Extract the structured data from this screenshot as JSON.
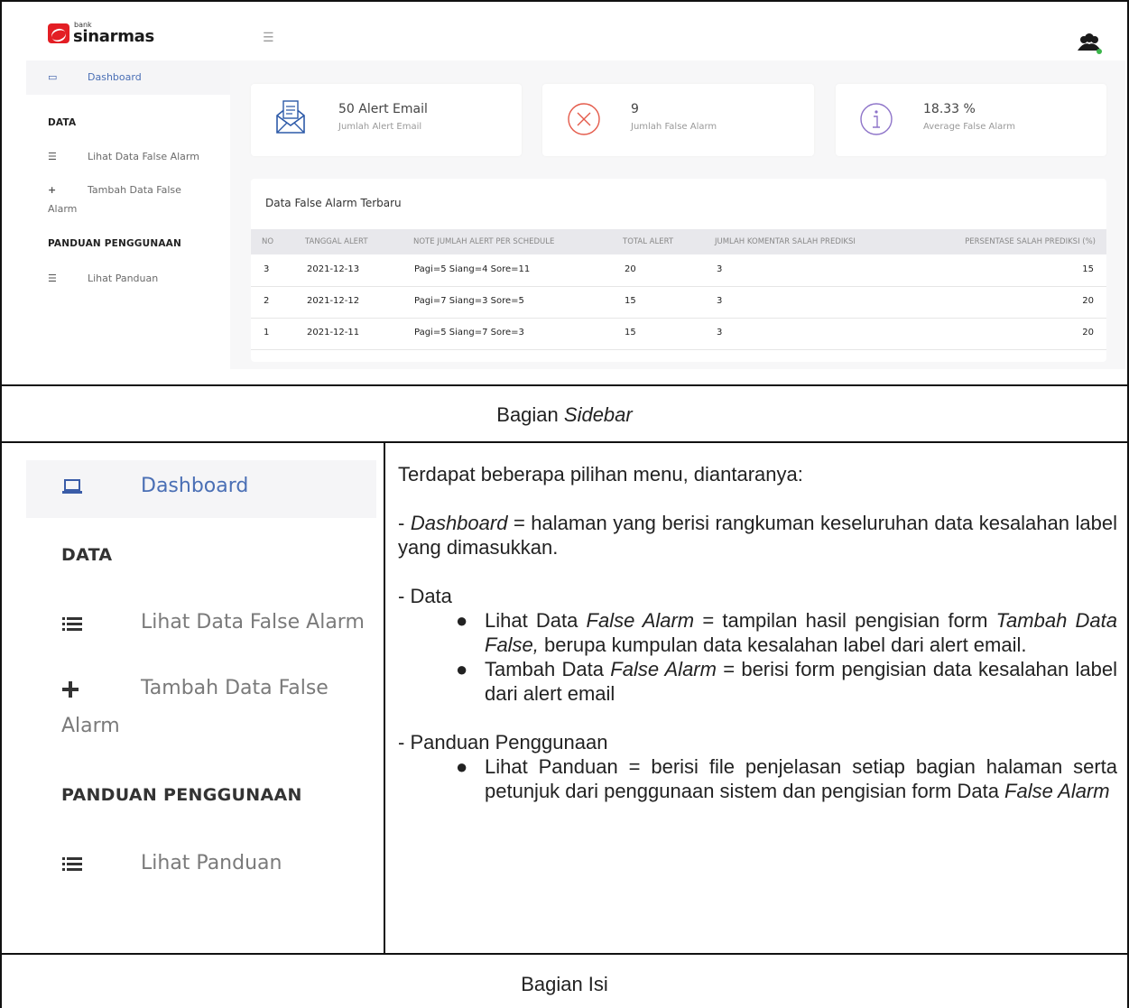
{
  "app": {
    "logo_small": "bank",
    "logo_name": "sinarmas"
  },
  "sidebar": {
    "dashboard": "Dashboard",
    "section_data": "DATA",
    "lihat_data": "Lihat Data False Alarm",
    "tambah_line1": "Tambah Data False",
    "tambah_line2": "Alarm",
    "section_panduan": "PANDUAN PENGGUNAAN",
    "lihat_panduan": "Lihat Panduan"
  },
  "cards": [
    {
      "value": "50 Alert Email",
      "label": "Jumlah Alert Email",
      "icon": "email-icon"
    },
    {
      "value": "9",
      "label": "Jumlah False Alarm",
      "icon": "x-circle-icon"
    },
    {
      "value": "18.33 %",
      "label": "Average False Alarm",
      "icon": "info-circle-icon"
    }
  ],
  "table": {
    "title": "Data False Alarm Terbaru",
    "headers": [
      "NO",
      "TANGGAL ALERT",
      "NOTE JUMLAH ALERT PER SCHEDULE",
      "TOTAL ALERT",
      "JUMLAH KOMENTAR SALAH PREDIKSI",
      "PERSENTASE SALAH PREDIKSI (%)"
    ],
    "rows": [
      [
        "3",
        "2021-12-13",
        "Pagi=5 Siang=4 Sore=11",
        "20",
        "3",
        "15"
      ],
      [
        "2",
        "2021-12-12",
        "Pagi=7 Siang=3 Sore=5",
        "15",
        "3",
        "20"
      ],
      [
        "1",
        "2021-12-11",
        "Pagi=5 Siang=7 Sore=3",
        "15",
        "3",
        "20"
      ]
    ]
  },
  "captions": {
    "sidebar_prefix": "Bagian ",
    "sidebar_italic": "Sidebar",
    "isi": "Bagian Isi"
  },
  "description": {
    "intro": "Terdapat beberapa pilihan menu, diantaranya:",
    "dash_dash": "- ",
    "dash_italic": "Dashboard",
    "dash_text": " = halaman yang berisi rangkuman keseluruhan data kesalahan label yang dimasukkan.",
    "data_heading": "- Data",
    "b1_a": "Lihat Data ",
    "b1_i1": "False Alarm",
    "b1_b": " = tampilan  hasil pengisian form ",
    "b1_i2": "Tambah Data False,",
    "b1_c": " berupa kumpulan data kesalahan label dari alert email.",
    "b2_a": "Tambah Data ",
    "b2_i": "False Alarm",
    "b2_b": " = berisi form pengisian data kesalahan label dari alert email",
    "panduan_heading": "- Panduan Penggunaan",
    "b3_a": "Lihat Panduan = berisi file penjelasan setiap bagian halaman serta petunjuk dari penggunaan sistem dan pengisian form Data ",
    "b3_i": "False Alarm",
    "bullet_char": "●"
  }
}
